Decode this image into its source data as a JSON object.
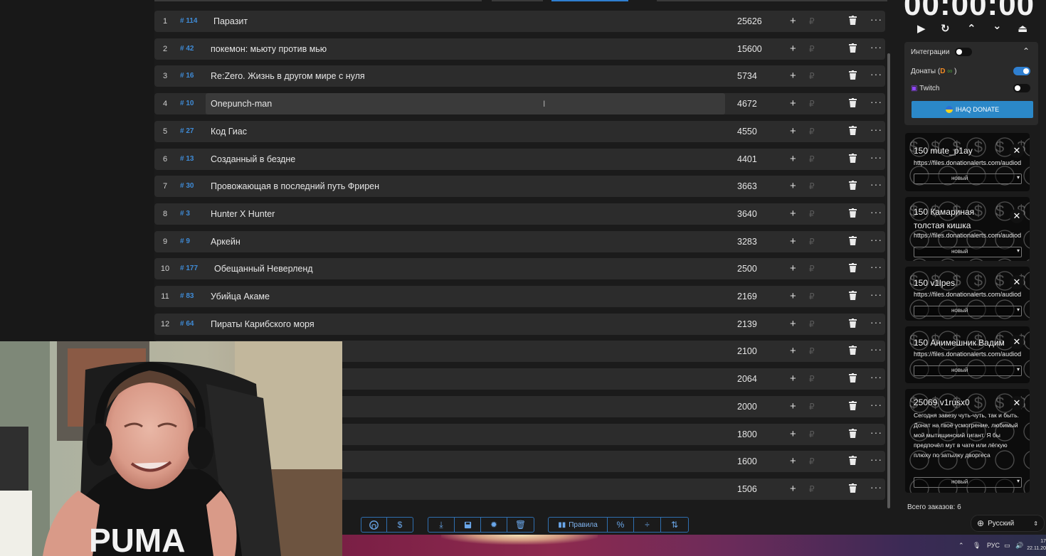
{
  "timer": {
    "display": "00:00:00"
  },
  "timer_controls": {
    "play": "▶",
    "restart": "↻",
    "up": "⌃",
    "down": "⌄",
    "eject": "⏏"
  },
  "lots": [
    {
      "index": "1",
      "tag": "# 114",
      "title": "Паразит",
      "amount": "25626"
    },
    {
      "index": "2",
      "tag": "# 42",
      "title": "покемон: мьюту против мью",
      "amount": "15600"
    },
    {
      "index": "3",
      "tag": "# 16",
      "title": "Re:Zero. Жизнь в другом мире с нуля",
      "amount": "5734"
    },
    {
      "index": "4",
      "tag": "# 10",
      "title": "Onepunch-man",
      "amount": "4672"
    },
    {
      "index": "5",
      "tag": "# 27",
      "title": "Код Гиас",
      "amount": "4550"
    },
    {
      "index": "6",
      "tag": "# 13",
      "title": "Созданный в бездне",
      "amount": "4401"
    },
    {
      "index": "7",
      "tag": "# 30",
      "title": "Провожающая в последний путь Фрирен",
      "amount": "3663"
    },
    {
      "index": "8",
      "tag": "# 3",
      "title": "Hunter X Hunter",
      "amount": "3640"
    },
    {
      "index": "9",
      "tag": "# 9",
      "title": "Аркейн",
      "amount": "3283"
    },
    {
      "index": "10",
      "tag": "# 177",
      "title": "Обещанный Неверленд",
      "amount": "2500"
    },
    {
      "index": "11",
      "tag": "# 83",
      "title": "Убийца Акаме",
      "amount": "2169"
    },
    {
      "index": "12",
      "tag": "# 64",
      "title": "Пираты Карибского моря",
      "amount": "2139"
    },
    {
      "index": "",
      "tag": "",
      "title": "",
      "amount": "2100"
    },
    {
      "index": "",
      "tag": "",
      "title": "",
      "amount": "2064"
    },
    {
      "index": "",
      "tag": "",
      "title": "",
      "amount": "2000"
    },
    {
      "index": "",
      "tag": "",
      "title": "",
      "amount": "1800"
    },
    {
      "index": "",
      "tag": "",
      "title": "",
      "amount": "1600"
    },
    {
      "index": "",
      "tag": "",
      "title": "",
      "amount": "1506"
    }
  ],
  "row_actions": {
    "plus": "+",
    "currency": "₽",
    "delete": "🗑",
    "more": "···"
  },
  "integrations": {
    "label": "Интеграции",
    "donations_label": "Донаты (",
    "donations_suffix": ")",
    "donations_enabled": true,
    "twitch_label": "Twitch",
    "twitch_enabled": false,
    "ihaq_button": "IHAQ DONATE"
  },
  "donations": [
    {
      "title": "150 mute_p1ay",
      "url": "https://files.donationalerts.com/audiod",
      "status": "новый"
    },
    {
      "title": "150 Камариная толстая кишка",
      "url": "https://files.donationalerts.com/audiod",
      "status": "новый"
    },
    {
      "title": "150 v1lpes",
      "url": "https://files.donationalerts.com/audiod",
      "status": "новый"
    },
    {
      "title": "150 Анимешник Вадим",
      "url": "https://files.donationalerts.com/audiod",
      "status": "новый"
    },
    {
      "title": "25069 v1rusx0",
      "message": "Сегодня завезу чуть-чуть, так и быть. Донат на твоё усмотрение, любимый мой мытищинский гигант. Я бы предпочёл мут в чате или лёгкую плюху по затылку дворгеса",
      "status": "новый"
    }
  ],
  "orders_total": "Всего заказов: 6",
  "language": "Русский",
  "toolbar": {
    "rules_label": "Правила",
    "percent": "%",
    "dollar": "$"
  },
  "taskbar": {
    "lang": "РУС",
    "time": "17",
    "date": "22.11.20"
  },
  "colors": {
    "accent": "#2f7fd0",
    "tag": "#3f8bd6",
    "row_bg": "#2c2c2c",
    "bg": "#1b1b1b"
  }
}
